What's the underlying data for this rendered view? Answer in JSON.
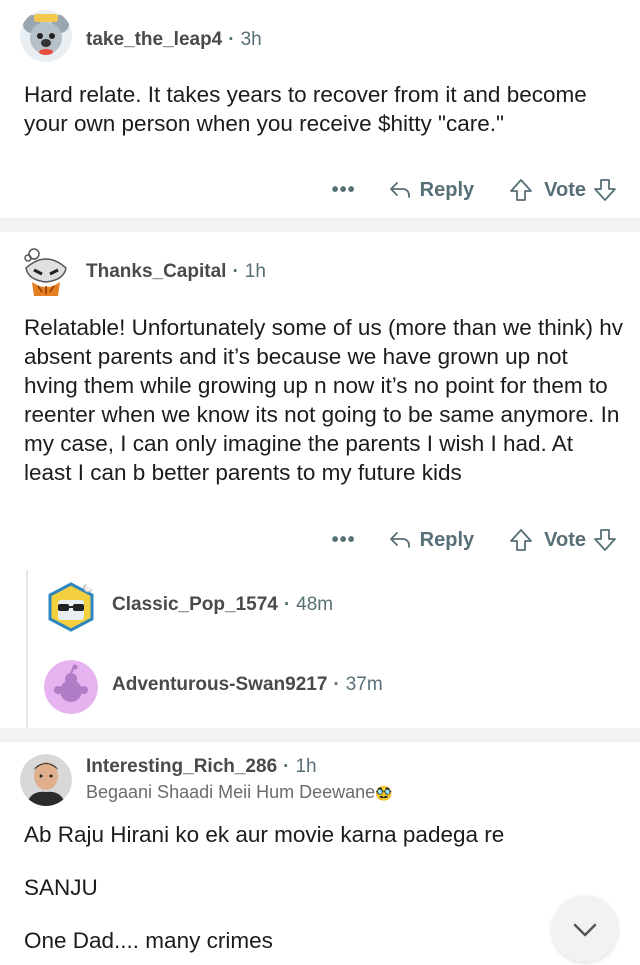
{
  "comments": [
    {
      "username": "take_the_leap4",
      "time": "3h",
      "body": [
        "Hard relate. It takes years to recover from it and become your own person when you receive $hitty \"care.\""
      ],
      "more": "•••",
      "reply_label": "Reply",
      "vote_label": "Vote",
      "avatar_icon": "koala-avatar-icon"
    },
    {
      "username": "Thanks_Capital",
      "time": "1h",
      "body": [
        "Relatable! Unfortunately some of us (more than we think) hv absent parents and it’s because we have grown up not hving them while growing up n now it’s no point for them to reenter when we know its not going to be same anymore. In my case, I can only imagine the parents I wish I had. At least I can b better parents to my future kids"
      ],
      "more": "•••",
      "reply_label": "Reply",
      "vote_label": "Vote",
      "avatar_icon": "ghost-mask-avatar-icon"
    }
  ],
  "collapsed_replies": [
    {
      "username": "Classic_Pop_1574",
      "time": "48m",
      "avatar_icon": "sunglasses-snoo-avatar-icon"
    },
    {
      "username": "Adventurous-Swan9217",
      "time": "37m",
      "avatar_icon": "default-snoo-avatar-icon"
    }
  ],
  "third_comment": {
    "username": "Interesting_Rich_286",
    "time": "1h",
    "flair": "Begaani Shaadi Meii Hum Deewane",
    "flair_emoji": "🥸",
    "lines": [
      "Ab Raju Hirani ko ek aur movie karna padega re",
      "SANJU",
      "One Dad.... many crimes"
    ],
    "avatar_icon": "man-photo-avatar-icon"
  },
  "colors": {
    "meta": "#576f76",
    "divider": "#f2f2f4",
    "text": "#1c1c1c"
  }
}
